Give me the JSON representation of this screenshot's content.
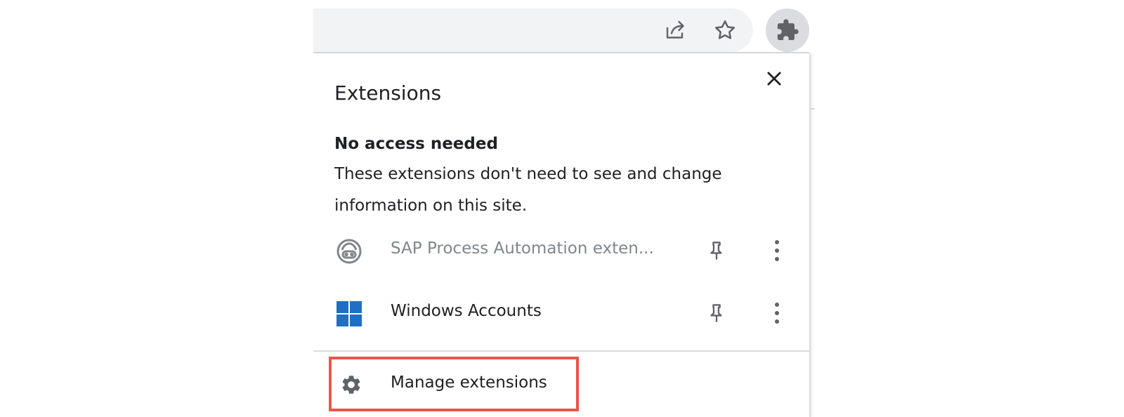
{
  "toolbar": {
    "share_icon": "share-icon",
    "star_icon": "star-icon",
    "extensions_icon": "puzzle-piece-icon"
  },
  "popup": {
    "title": "Extensions",
    "close_icon": "close-icon",
    "section": {
      "heading": "No access needed",
      "description": "These extensions don't need to see and change information on this site."
    },
    "extensions": [
      {
        "name": "SAP Process Automation exten...",
        "icon": "sap-bot-icon",
        "pin_icon": "pin-icon",
        "more_icon": "more-vert-icon"
      },
      {
        "name": "Windows Accounts",
        "icon": "windows-logo-icon",
        "pin_icon": "pin-icon",
        "more_icon": "more-vert-icon"
      }
    ],
    "manage": {
      "label": "Manage extensions",
      "icon": "gear-icon",
      "highlight_color": "#e8564b"
    }
  },
  "colors": {
    "omnibox_bg": "#f1f3f4",
    "extensions_button_bg": "#dadce0",
    "windows_blue": "#1f6fc5",
    "muted_text": "#80868b"
  }
}
